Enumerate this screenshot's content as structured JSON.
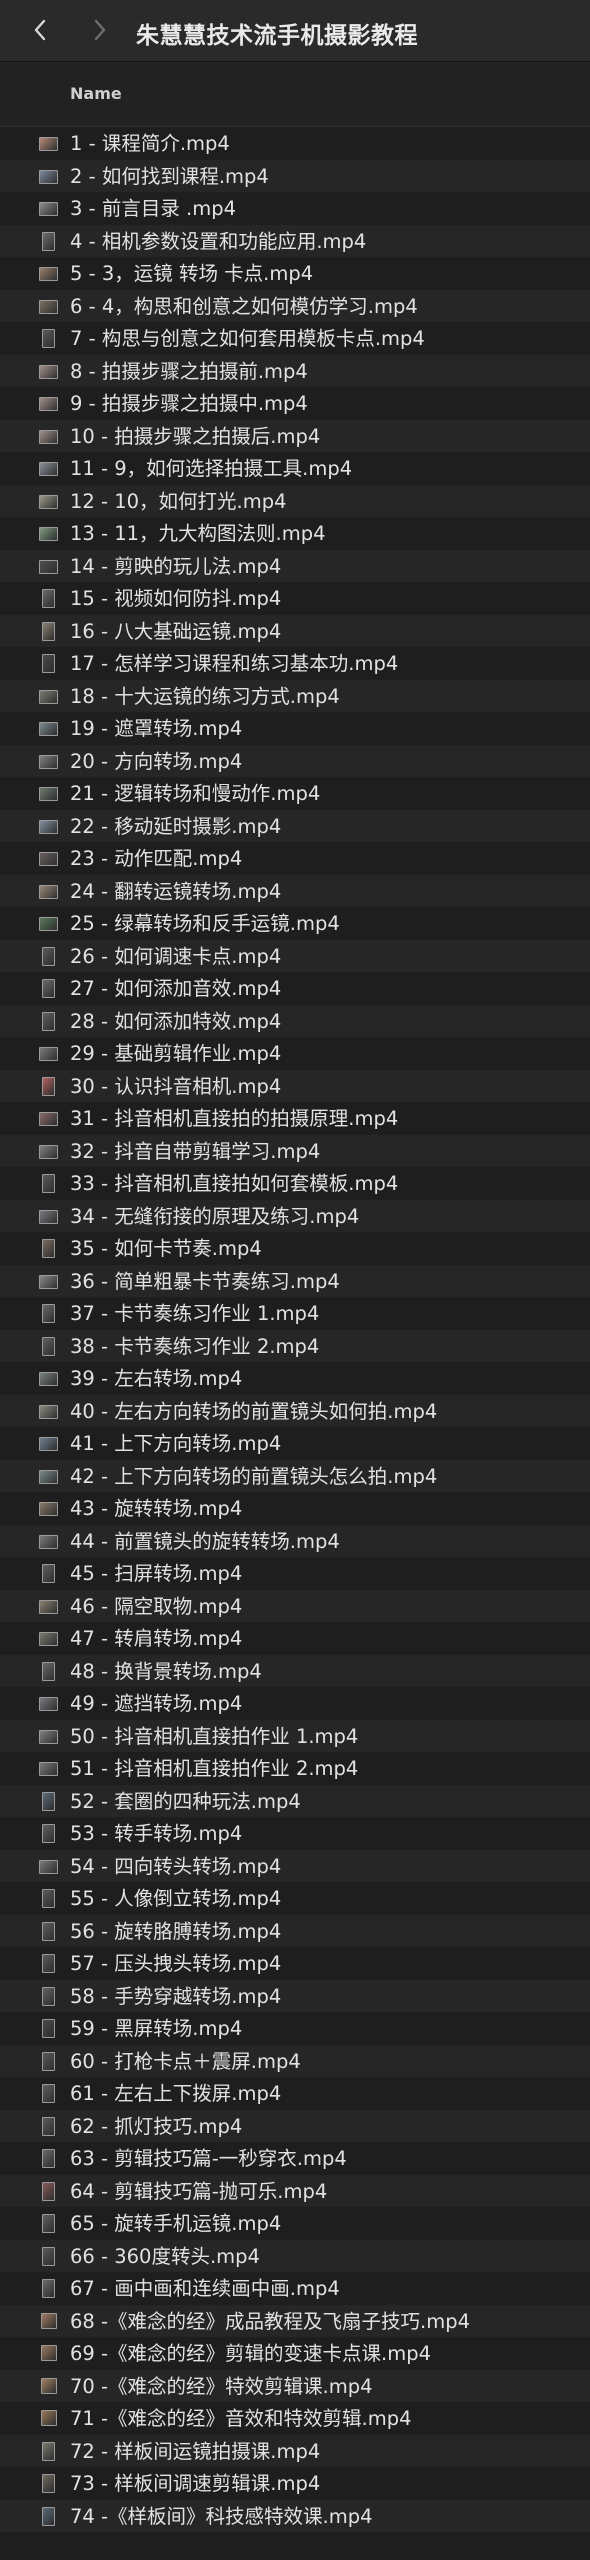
{
  "window": {
    "title": "朱慧慧技术流手机摄影教程"
  },
  "toolbar": {
    "back_icon": "chevron-left-icon",
    "forward_icon": "chevron-right-icon"
  },
  "list_header": {
    "name_label": "Name"
  },
  "files": [
    {
      "name": "1 - 课程简介.mp4",
      "thumb": "wide",
      "color": "#b88a7a"
    },
    {
      "name": "2 - 如何找到课程.mp4",
      "thumb": "wide",
      "color": "#7b8aa0"
    },
    {
      "name": "3 - 前言目录 .mp4",
      "thumb": "wide",
      "color": "#8c8c8c"
    },
    {
      "name": "4 - 相机参数设置和功能应用.mp4",
      "thumb": "tall",
      "color": "#6d6d6d"
    },
    {
      "name": "5 - 3，运镜 转场 卡点.mp4",
      "thumb": "wide",
      "color": "#9a7f6a"
    },
    {
      "name": "6 - 4，构思和创意之如何模仿学习.mp4",
      "thumb": "wide",
      "color": "#7a7060"
    },
    {
      "name": "7 - 构思与创意之如何套用模板卡点.mp4",
      "thumb": "tall",
      "color": "#5a5a5a"
    },
    {
      "name": "8 - 拍摄步骤之拍摄前.mp4",
      "thumb": "wide",
      "color": "#a0908a"
    },
    {
      "name": "9 - 拍摄步骤之拍摄中.mp4",
      "thumb": "wide",
      "color": "#a0908a"
    },
    {
      "name": "10 - 拍摄步骤之拍摄后.mp4",
      "thumb": "wide",
      "color": "#a0908a"
    },
    {
      "name": "11 - 9，如何选择拍摄工具.mp4",
      "thumb": "wide",
      "color": "#8a8f98"
    },
    {
      "name": "12 - 10，如何打光.mp4",
      "thumb": "wide",
      "color": "#9a9a8a"
    },
    {
      "name": "13 - 11，九大构图法则.mp4",
      "thumb": "wide",
      "color": "#7f9a80"
    },
    {
      "name": "14 - 剪映的玩儿法.mp4",
      "thumb": "wide",
      "color": "#505050"
    },
    {
      "name": "15 - 视频如何防抖.mp4",
      "thumb": "tall",
      "color": "#6a6a6a"
    },
    {
      "name": "16 - 八大基础运镜.mp4",
      "thumb": "tall",
      "color": "#8a8070"
    },
    {
      "name": "17 - 怎样学习课程和练习基本功.mp4",
      "thumb": "tall",
      "color": "#4a4a4a"
    },
    {
      "name": "18 - 十大运镜的练习方式.mp4",
      "thumb": "wide",
      "color": "#7d7d75"
    },
    {
      "name": "19 - 遮罩转场.mp4",
      "thumb": "wide",
      "color": "#7a8a90"
    },
    {
      "name": "20 - 方向转场.mp4",
      "thumb": "wide",
      "color": "#808080"
    },
    {
      "name": "21 - 逻辑转场和慢动作.mp4",
      "thumb": "wide",
      "color": "#707a70"
    },
    {
      "name": "22 - 移动延时摄影.mp4",
      "thumb": "wide",
      "color": "#8090a0"
    },
    {
      "name": "23 - 动作匹配.mp4",
      "thumb": "wide",
      "color": "#6a6060"
    },
    {
      "name": "24 - 翻转运镜转场.mp4",
      "thumb": "wide",
      "color": "#9a8a7a"
    },
    {
      "name": "25 - 绿幕转场和反手运镜.mp4",
      "thumb": "wide",
      "color": "#5a7a5a"
    },
    {
      "name": "26 - 如何调速卡点.mp4",
      "thumb": "tall",
      "color": "#5a5a5a"
    },
    {
      "name": "27 - 如何添加音效.mp4",
      "thumb": "tall",
      "color": "#6a6a6a"
    },
    {
      "name": "28 - 如何添加特效.mp4",
      "thumb": "tall",
      "color": "#606060"
    },
    {
      "name": "29 - 基础剪辑作业.mp4",
      "thumb": "wide",
      "color": "#7a7a7a"
    },
    {
      "name": "30 - 认识抖音相机.mp4",
      "thumb": "tall",
      "color": "#b06060"
    },
    {
      "name": "31 - 抖音相机直接拍的拍摄原理.mp4",
      "thumb": "wide",
      "color": "#8a6a6a"
    },
    {
      "name": "32 - 抖音自带剪辑学习.mp4",
      "thumb": "wide",
      "color": "#808080"
    },
    {
      "name": "33 - 抖音相机直接拍如何套模板.mp4",
      "thumb": "tall",
      "color": "#5a5a5a"
    },
    {
      "name": "34 - 无缝衔接的原理及练习.mp4",
      "thumb": "wide",
      "color": "#7a7a80"
    },
    {
      "name": "35 - 如何卡节奏.mp4",
      "thumb": "tall",
      "color": "#7a6a60"
    },
    {
      "name": "36 - 简单粗暴卡节奏练习.mp4",
      "thumb": "wide",
      "color": "#8a8a8a"
    },
    {
      "name": "37 - 卡节奏练习作业 1.mp4",
      "thumb": "tall",
      "color": "#6a6a6a"
    },
    {
      "name": "38 - 卡节奏练习作业 2.mp4",
      "thumb": "tall",
      "color": "#606060"
    },
    {
      "name": "39 - 左右转场.mp4",
      "thumb": "wide",
      "color": "#7a8080"
    },
    {
      "name": "40 - 左右方向转场的前置镜头如何拍.mp4",
      "thumb": "wide",
      "color": "#8a8a80"
    },
    {
      "name": "41 - 上下方向转场.mp4",
      "thumb": "wide",
      "color": "#708090"
    },
    {
      "name": "42 - 上下方向转场的前置镜头怎么拍.mp4",
      "thumb": "wide",
      "color": "#7a8a8a"
    },
    {
      "name": "43 - 旋转转场.mp4",
      "thumb": "wide",
      "color": "#8a7a6a"
    },
    {
      "name": "44 - 前置镜头的旋转转场.mp4",
      "thumb": "wide",
      "color": "#7a7a7a"
    },
    {
      "name": "45 - 扫屏转场.mp4",
      "thumb": "tall",
      "color": "#606060"
    },
    {
      "name": "46 - 隔空取物.mp4",
      "thumb": "wide",
      "color": "#8a8070"
    },
    {
      "name": "47 - 转肩转场.mp4",
      "thumb": "wide",
      "color": "#7a7a70"
    },
    {
      "name": "48 - 换背景转场.mp4",
      "thumb": "tall",
      "color": "#6a6a6a"
    },
    {
      "name": "49 - 遮挡转场.mp4",
      "thumb": "wide",
      "color": "#7a7a80"
    },
    {
      "name": "50 - 抖音相机直接拍作业 1.mp4",
      "thumb": "wide",
      "color": "#808080"
    },
    {
      "name": "51 - 抖音相机直接拍作业 2.mp4",
      "thumb": "wide",
      "color": "#7a7a7a"
    },
    {
      "name": "52 - 套圈的四种玩法.mp4",
      "thumb": "tall",
      "color": "#5a6a7a"
    },
    {
      "name": "53 - 转手转场.mp4",
      "thumb": "tall",
      "color": "#606060"
    },
    {
      "name": "54 - 四向转头转场.mp4",
      "thumb": "wide",
      "color": "#7a7a7a"
    },
    {
      "name": "55 - 人像倒立转场.mp4",
      "thumb": "tall",
      "color": "#5a5a5a"
    },
    {
      "name": "56 - 旋转胳膊转场.mp4",
      "thumb": "tall",
      "color": "#606060"
    },
    {
      "name": "57 - 压头拽头转场.mp4",
      "thumb": "tall",
      "color": "#5a5a5a"
    },
    {
      "name": "58 - 手势穿越转场.mp4",
      "thumb": "tall",
      "color": "#626262"
    },
    {
      "name": "59 - 黑屏转场.mp4",
      "thumb": "tall",
      "color": "#4a4a4a"
    },
    {
      "name": "60 - 打枪卡点＋震屏.mp4",
      "thumb": "tall",
      "color": "#5a5a5a"
    },
    {
      "name": "61 - 左右上下拨屏.mp4",
      "thumb": "tall",
      "color": "#606060"
    },
    {
      "name": "62 - 抓灯技巧.mp4",
      "thumb": "tall",
      "color": "#5a5a5a"
    },
    {
      "name": "63 - 剪辑技巧篇-一秒穿衣.mp4",
      "thumb": "tall",
      "color": "#6a6a6a"
    },
    {
      "name": "64 - 剪辑技巧篇-抛可乐.mp4",
      "thumb": "tall",
      "color": "#8a5a5a"
    },
    {
      "name": "65 - 旋转手机运镜.mp4",
      "thumb": "tall",
      "color": "#606060"
    },
    {
      "name": "66 - 360度转头.mp4",
      "thumb": "tall",
      "color": "#5a5a5a"
    },
    {
      "name": "67 - 画中画和连续画中画.mp4",
      "thumb": "tall",
      "color": "#6a6a6a"
    },
    {
      "name": "68 -《难念的经》成品教程及飞扇子技巧.mp4",
      "thumb": "square",
      "color": "#a07a60"
    },
    {
      "name": "69 -《难念的经》剪辑的变速卡点课.mp4",
      "thumb": "square",
      "color": "#9a7a60"
    },
    {
      "name": "70 -《难念的经》特效剪辑课.mp4",
      "thumb": "square",
      "color": "#a08060"
    },
    {
      "name": "71 -《难念的经》音效和特效剪辑.mp4",
      "thumb": "square",
      "color": "#9a7a5a"
    },
    {
      "name": "72 - 样板间运镜拍摄课.mp4",
      "thumb": "tall",
      "color": "#7a7a70"
    },
    {
      "name": "73 - 样板间调速剪辑课.mp4",
      "thumb": "tall",
      "color": "#706a60"
    },
    {
      "name": "74 -《样板间》科技感特效课.mp4",
      "thumb": "tall",
      "color": "#5a6a7a"
    }
  ]
}
